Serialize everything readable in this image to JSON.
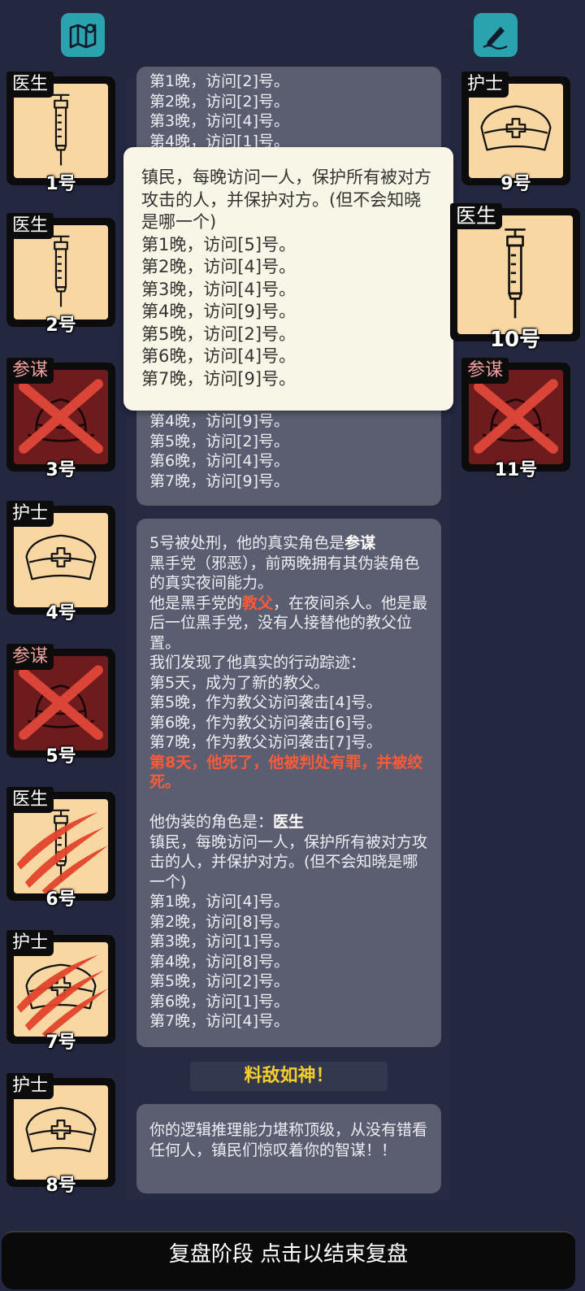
{
  "top_icons": {
    "left": "map-icon",
    "right": "edit-icon"
  },
  "players_left": [
    {
      "role": "医生",
      "num": "1号",
      "icon": "syringe",
      "state": "alive"
    },
    {
      "role": "医生",
      "num": "2号",
      "icon": "syringe",
      "state": "alive"
    },
    {
      "role": "参谋",
      "num": "3号",
      "icon": "hat",
      "state": "dead"
    },
    {
      "role": "护士",
      "num": "4号",
      "icon": "nurse-cap",
      "state": "alive"
    },
    {
      "role": "参谋",
      "num": "5号",
      "icon": "hat",
      "state": "dead"
    },
    {
      "role": "医生",
      "num": "6号",
      "icon": "syringe",
      "state": "killed"
    },
    {
      "role": "护士",
      "num": "7号",
      "icon": "nurse-cap",
      "state": "killed"
    },
    {
      "role": "护士",
      "num": "8号",
      "icon": "nurse-cap",
      "state": "alive"
    }
  ],
  "players_right": [
    {
      "role": "护士",
      "num": "9号",
      "icon": "nurse-cap",
      "state": "alive"
    },
    {
      "role": "医生",
      "num": "10号",
      "icon": "syringe",
      "state": "alive"
    },
    {
      "role": "参谋",
      "num": "11号",
      "icon": "hat",
      "state": "dead"
    }
  ],
  "log1": {
    "top_lines": [
      "第1晚，访问[2]号。",
      "第2晚，访问[2]号。",
      "第3晚，访问[4]号。",
      "第4晚，访问[1]号。"
    ],
    "bottom_lines": [
      "第4晚，访问[9]号。",
      "第5晚，访问[2]号。",
      "第6晚，访问[4]号。",
      "第7晚，访问[9]号。"
    ]
  },
  "tooltip": {
    "desc": "镇民，每晚访问一人，保护所有被对方攻击的人，并保护对方。(但不会知晓是哪一个)",
    "lines": [
      "第1晚，访问[5]号。",
      "第2晚，访问[4]号。",
      "第3晚，访问[4]号。",
      "第4晚，访问[9]号。",
      "第5晚，访问[2]号。",
      "第6晚，访问[4]号。",
      "第7晚，访问[9]号。"
    ]
  },
  "log2": {
    "exec_prefix": "5号被处刑，他的真实角色是",
    "exec_role": "参谋",
    "exec_desc": "黑手党（邪恶），前两晚拥有其伪装角色的真实夜间能力。",
    "godfather_prefix": "他是黑手党的",
    "godfather_word": "教父",
    "godfather_suffix": "，在夜间杀人。他是最后一位黑手党，没有人接替他的教父位置。",
    "trace_lines": [
      "我们发现了他真实的行动踪迹：",
      "第5天，成为了新的教父。",
      "第5晚，作为教父访问袭击[4]号。",
      "第6晚，作为教父访问袭击[6]号。",
      "第7晚，作为教父访问袭击[7]号。"
    ],
    "death_text": "第8天，他死了，他被判处有罪，并被绞死。",
    "disguise_prefix": "他伪装的角色是：",
    "disguise_role": "医生",
    "disguise_desc": "镇民，每晚访问一人，保护所有被对方攻击的人，并保护对方。(但不会知晓是哪一个)",
    "disguise_lines": [
      "第1晚，访问[4]号。",
      "第2晚，访问[8]号。",
      "第3晚，访问[1]号。",
      "第4晚，访问[8]号。",
      "第5晚，访问[2]号。",
      "第6晚，访问[1]号。",
      "第7晚，访问[4]号。"
    ]
  },
  "rating": {
    "title": "料敌如神！",
    "text": "你的逻辑推理能力堪称顶级，从没有错看任何人，镇民们惊叹着你的智谋！！"
  },
  "bottom_bar": "复盘阶段 点击以结束复盘"
}
